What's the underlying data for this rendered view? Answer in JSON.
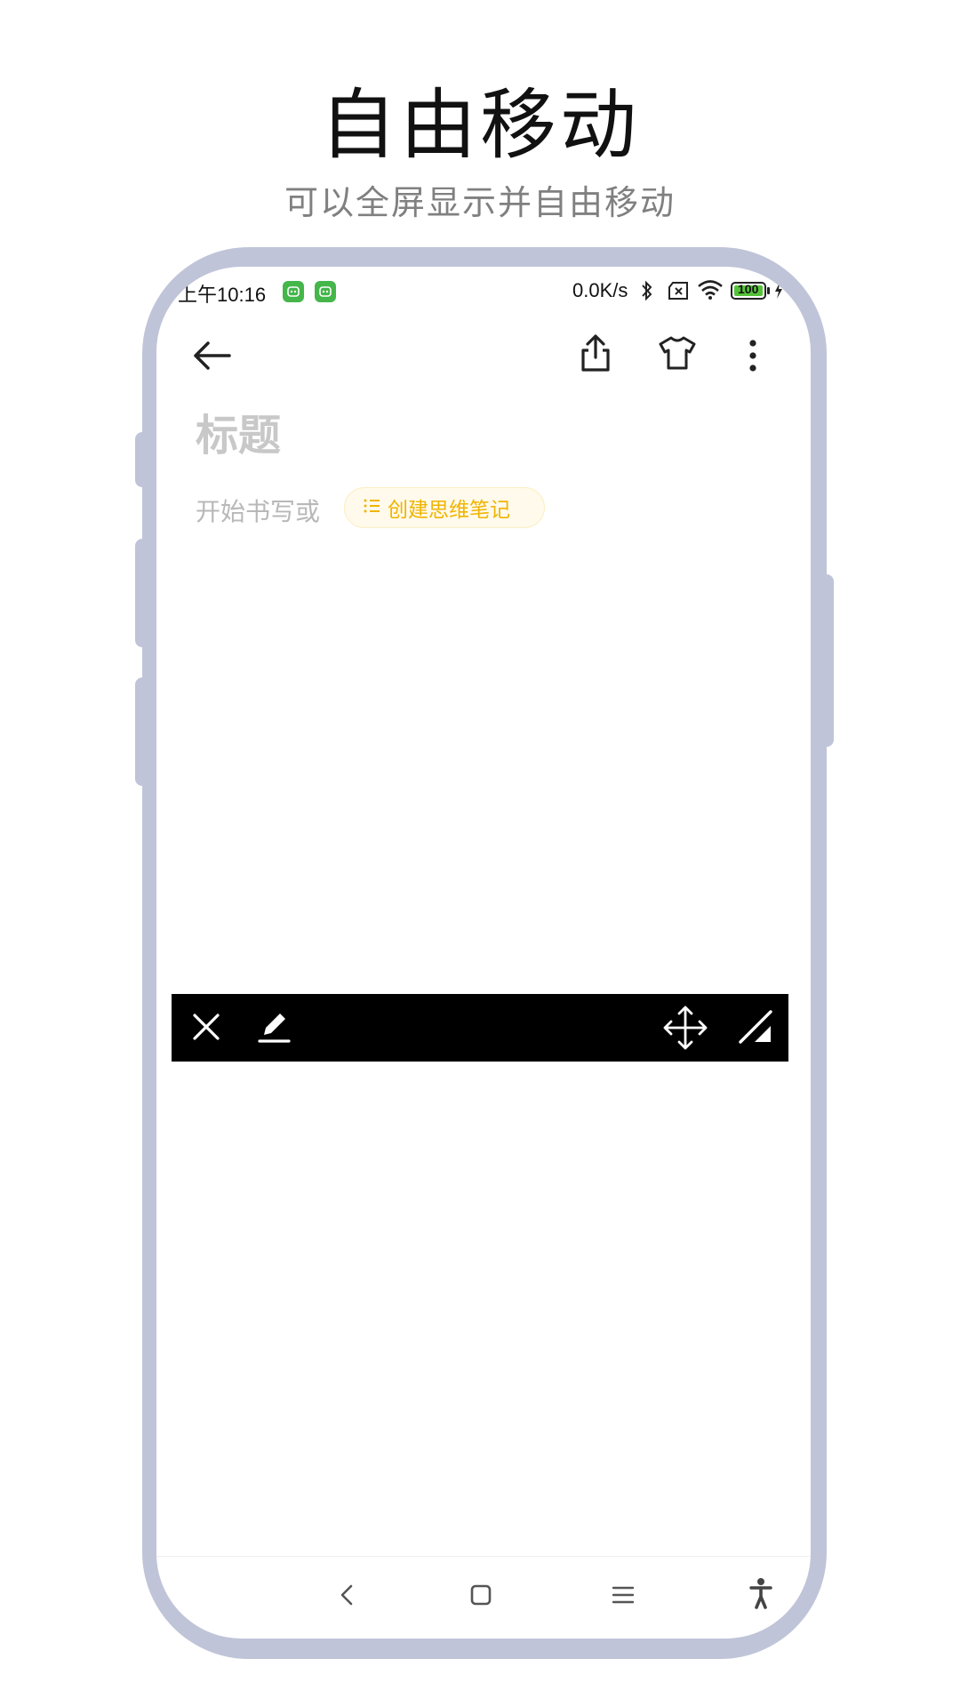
{
  "promo": {
    "title": "自由移动",
    "subtitle": "可以全屏显示并自由移动"
  },
  "status_bar": {
    "time": "上午10:16",
    "network_speed": "0.0K/s",
    "battery": "100",
    "icons": [
      "app-notification-icon",
      "app-notification-icon",
      "bluetooth-icon",
      "sim-off-icon",
      "wifi-icon",
      "battery-icon",
      "charging-icon"
    ]
  },
  "toolbar": {
    "icons": [
      "back-arrow-icon",
      "share-icon",
      "theme-shirt-icon",
      "more-vertical-icon"
    ]
  },
  "editor": {
    "title_placeholder": "标题",
    "body_placeholder": "开始书写或",
    "mind_map_chip": "创建思维笔记",
    "chip_icon": "list-icon",
    "chip_color": "#F0B400"
  },
  "floating_bar": {
    "icons": [
      "close-icon",
      "edit-pen-icon",
      "move-icon",
      "resize-icon"
    ],
    "background": "#000000"
  },
  "nav_bar": {
    "icons": [
      "nav-back-icon",
      "nav-home-icon",
      "nav-menu-icon",
      "accessibility-icon"
    ]
  },
  "colors": {
    "phone_frame": "#C0C4D8",
    "status_app_badge": "#44B64A"
  }
}
